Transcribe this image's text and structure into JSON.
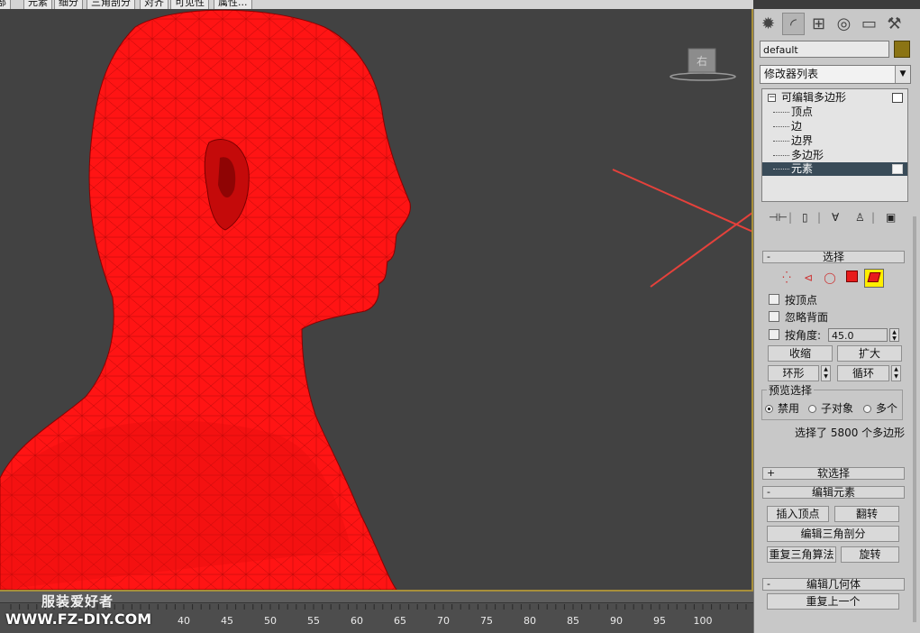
{
  "top_tabs": [
    "全部",
    "元素",
    "细分",
    "三角剖分",
    "对齐",
    "可见性",
    "属性..."
  ],
  "viewcube_label": "右",
  "timeline": {
    "ticks": [
      "40",
      "45",
      "50",
      "55",
      "60",
      "65",
      "70",
      "75",
      "80",
      "85",
      "90",
      "95",
      "100"
    ]
  },
  "watermark": {
    "line1": "服装爱好者",
    "line2": "WWW.FZ-DIY.COM"
  },
  "panel": {
    "tabs": [
      "create-icon",
      "modify-icon",
      "hierarchy-icon",
      "motion-icon",
      "display-icon",
      "utilities-icon"
    ],
    "object_name": "default",
    "object_color": "#8b7414",
    "modifier_list": "修改器列表",
    "stack": {
      "root": "可编辑多边形",
      "items": [
        "顶点",
        "边",
        "边界",
        "多边形",
        "元素"
      ],
      "selected": "元素"
    }
  },
  "selection_rollout": {
    "title": "选择",
    "by_vertex": "按顶点",
    "ignore_backfacing": "忽略背面",
    "by_angle": "按角度:",
    "angle_value": "45.0",
    "shrink": "收缩",
    "grow": "扩大",
    "ring": "环形",
    "loop": "循环",
    "preview_title": "预览选择",
    "preview_options": [
      "禁用",
      "子对象",
      "多个"
    ],
    "preview_selected": "禁用",
    "status": "选择了 5800 个多边形"
  },
  "soft_selection": {
    "title": "软选择"
  },
  "edit_elements": {
    "title": "编辑元素",
    "insert_vertex": "插入顶点",
    "flip": "翻转",
    "edit_triangulation": "编辑三角剖分",
    "retriangulate": "重复三角算法",
    "turn": "旋转"
  },
  "edit_geometry": {
    "title": "编辑几何体",
    "repeat_last": "重复上一个"
  },
  "colors": {
    "viewport_bg": "#424242",
    "mesh": "#ff0d0d",
    "selection_accent": "#e81c1c",
    "active_viewport_border": "#a88f3a",
    "annotation_arrow": "#e5413b"
  }
}
